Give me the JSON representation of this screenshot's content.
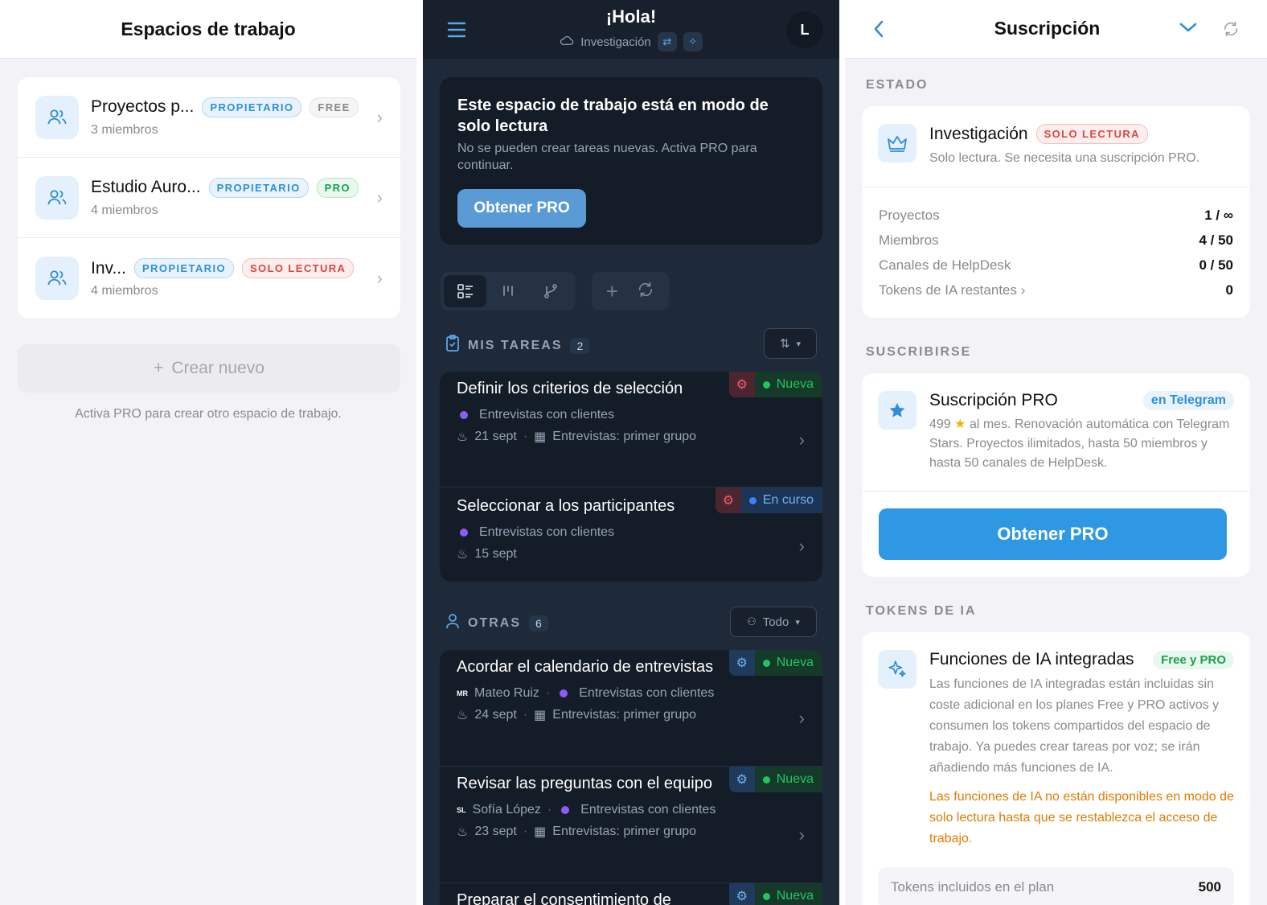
{
  "left": {
    "title": "Espacios de trabajo",
    "workspaces": [
      {
        "name": "Proyectos p...",
        "members": "3 miembros",
        "badges": [
          "PROPIETARIO",
          "FREE"
        ]
      },
      {
        "name": "Estudio Auro...",
        "members": "4 miembros",
        "badges": [
          "PROPIETARIO",
          "PRO"
        ]
      },
      {
        "name": "Inv...",
        "members": "4 miembros",
        "badges": [
          "PROPIETARIO",
          "SOLO LECTURA"
        ]
      }
    ],
    "create_label": "Crear nuevo",
    "create_note": "Activa PRO para crear otro espacio de trabajo."
  },
  "middle": {
    "greeting": "¡Hola!",
    "workspace": "Investigación",
    "avatar_initial": "L",
    "readonly": {
      "title": "Este espacio de trabajo está en modo de solo lectura",
      "desc": "No se pueden crear tareas nuevas. Activa PRO para continuar.",
      "button": "Obtener PRO"
    },
    "my_tasks": {
      "label": "MIS TAREAS",
      "count": "2",
      "tasks": [
        {
          "title": "Definir los criterios de selección",
          "status": "Nueva",
          "project": "Entrevistas con clientes",
          "date": "21 sept",
          "group": "Entrevistas: primer grupo"
        },
        {
          "title": "Seleccionar a los participantes",
          "status": "En curso",
          "project": "Entrevistas con clientes",
          "date": "15 sept"
        }
      ]
    },
    "others": {
      "label": "OTRAS",
      "count": "6",
      "filter": "Todo",
      "tasks": [
        {
          "title": "Acordar el calendario de entrevistas",
          "status": "Nueva",
          "assignee_initials": "MR",
          "assignee": "Mateo Ruiz",
          "project": "Entrevistas con clientes",
          "date": "24 sept",
          "group": "Entrevistas: primer grupo"
        },
        {
          "title": "Revisar las preguntas con el equipo",
          "status": "Nueva",
          "assignee_initials": "SL",
          "assignee": "Sofía López",
          "project": "Entrevistas con clientes",
          "date": "23 sept",
          "group": "Entrevistas: primer grupo"
        },
        {
          "title": "Preparar el consentimiento de",
          "status": "Nueva"
        }
      ]
    }
  },
  "right": {
    "title": "Suscripción",
    "estado_label": "ESTADO",
    "workspace_name": "Investigación",
    "workspace_badge": "SOLO LECTURA",
    "workspace_desc": "Solo lectura. Se necesita una suscripción PRO.",
    "limits": [
      {
        "label": "Proyectos",
        "value": "1 / ∞"
      },
      {
        "label": "Miembros",
        "value": "4 / 50"
      },
      {
        "label": "Canales de HelpDesk",
        "value": "0 / 50"
      },
      {
        "label": "Tokens de IA restantes",
        "value": "0"
      }
    ],
    "subscribe_label": "SUSCRIBIRSE",
    "plan_title": "Suscripción PRO",
    "plan_badge": "en Telegram",
    "plan_desc_price": "499",
    "plan_desc_rest": "al mes. Renovación automática con Telegram Stars. Proyectos ilimitados, hasta 50 miembros y hasta 50 canales de HelpDesk.",
    "pro_button": "Obtener PRO",
    "tokens_label": "TOKENS DE IA",
    "ai_title": "Funciones de IA integradas",
    "ai_badge": "Free y PRO",
    "ai_desc": "Las funciones de IA integradas están incluidas sin coste adicional en los planes Free y PRO activos y consumen los tokens compartidos del espacio de trabajo. Ya puedes crear tareas por voz; se irán añadiendo más funciones de IA.",
    "ai_warning": "Las funciones de IA no están disponibles en modo de solo lectura hasta que se restablezca el acceso de trabajo.",
    "tokens_row_label": "Tokens incluidos en el plan",
    "tokens_row_value": "500"
  },
  "colors": {
    "accent": "#2f98e3",
    "dark_bg": "#1e2a39",
    "card_dark": "#141c27",
    "success": "#22c55e",
    "danger": "#d9463f",
    "warning": "#e07b00"
  }
}
